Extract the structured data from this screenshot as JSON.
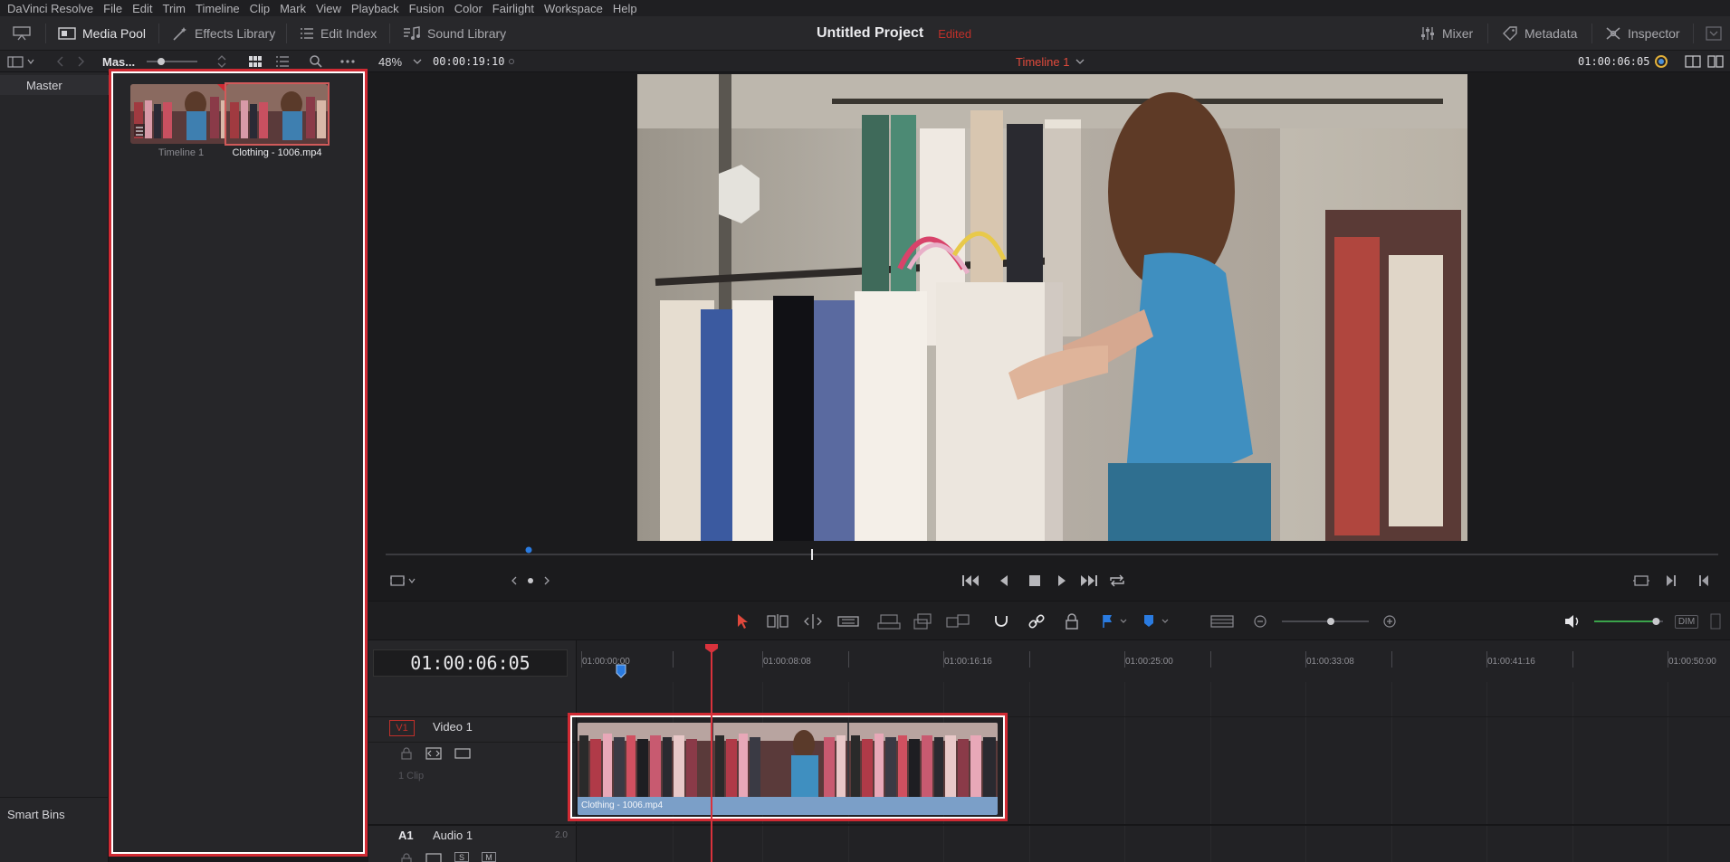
{
  "menu": [
    "DaVinci Resolve",
    "File",
    "Edit",
    "Trim",
    "Timeline",
    "Clip",
    "Mark",
    "View",
    "Playback",
    "Fusion",
    "Color",
    "Fairlight",
    "Workspace",
    "Help"
  ],
  "toolbar": {
    "media_pool": "Media Pool",
    "effects_library": "Effects Library",
    "edit_index": "Edit Index",
    "sound_library": "Sound Library",
    "project_title": "Untitled Project",
    "edited": "Edited",
    "mixer": "Mixer",
    "metadata": "Metadata",
    "inspector": "Inspector"
  },
  "subbar": {
    "bin_name": "Mas...",
    "zoom": "48%",
    "source_timecode": "00:00:19:10",
    "timeline_name": "Timeline 1",
    "record_timecode": "01:00:06:05"
  },
  "bins": {
    "master": "Master",
    "smart_bins": "Smart Bins"
  },
  "media_pool": {
    "clips": [
      {
        "name": "Timeline 1"
      },
      {
        "name": "Clothing - 1006.mp4"
      }
    ]
  },
  "timeline": {
    "timecode": "01:00:06:05",
    "ruler_labels": [
      "01:00:00:00",
      "01:00:08:08",
      "01:00:16:16",
      "01:00:25:00",
      "01:00:33:08",
      "01:00:41:16",
      "01:00:50:00"
    ],
    "video_track": {
      "id": "V1",
      "name": "Video 1",
      "clip_count": "1 Clip"
    },
    "audio_track": {
      "id": "A1",
      "name": "Audio 1",
      "channels": "2.0"
    },
    "clip_name": "Clothing - 1006.mp4"
  },
  "monitor": {
    "dim_label": "DIM",
    "volume": 0.9
  },
  "colors": {
    "accent_red": "#d02a33",
    "clip_blue": "#7b9fc8",
    "edited_red": "#c0302a",
    "volume_green": "#3aa34a"
  }
}
